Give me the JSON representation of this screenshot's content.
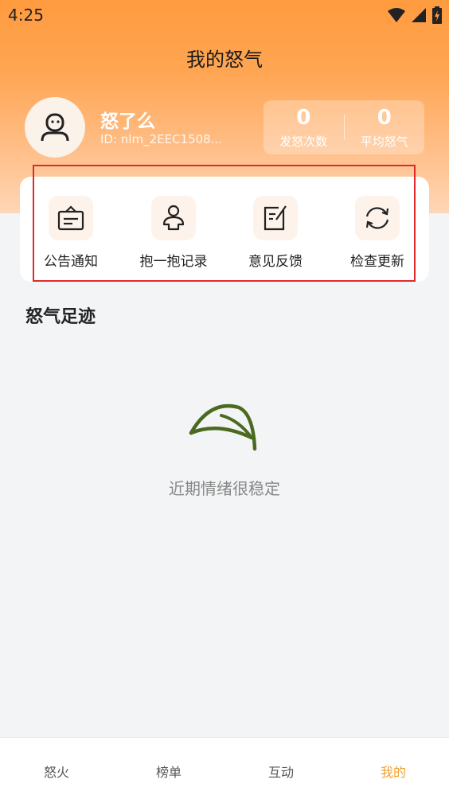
{
  "status_bar": {
    "time": "4:25"
  },
  "header": {
    "title": "我的怒气"
  },
  "profile": {
    "name": "怒了么",
    "id_text": "ID: nlm_2EEC1508..."
  },
  "stats": [
    {
      "value": "0",
      "label": "发怒次数"
    },
    {
      "value": "0",
      "label": "平均怒气"
    }
  ],
  "menu": [
    {
      "label": "公告通知",
      "icon": "announcement-icon"
    },
    {
      "label": "抱一抱记录",
      "icon": "hug-icon"
    },
    {
      "label": "意见反馈",
      "icon": "feedback-icon"
    },
    {
      "label": "检查更新",
      "icon": "refresh-icon"
    }
  ],
  "section": {
    "title": "怒气足迹"
  },
  "empty_state": {
    "text": "近期情绪很稳定",
    "icon": "leaf-icon"
  },
  "tabs": [
    {
      "label": "怒火"
    },
    {
      "label": "榜单"
    },
    {
      "label": "互动"
    },
    {
      "label": "我的"
    }
  ],
  "colors": {
    "accent": "#f0a030",
    "header_gradient_top": "#ff9b3f",
    "leaf": "#4a6a1f",
    "highlight_outline": "#e02a2a"
  }
}
